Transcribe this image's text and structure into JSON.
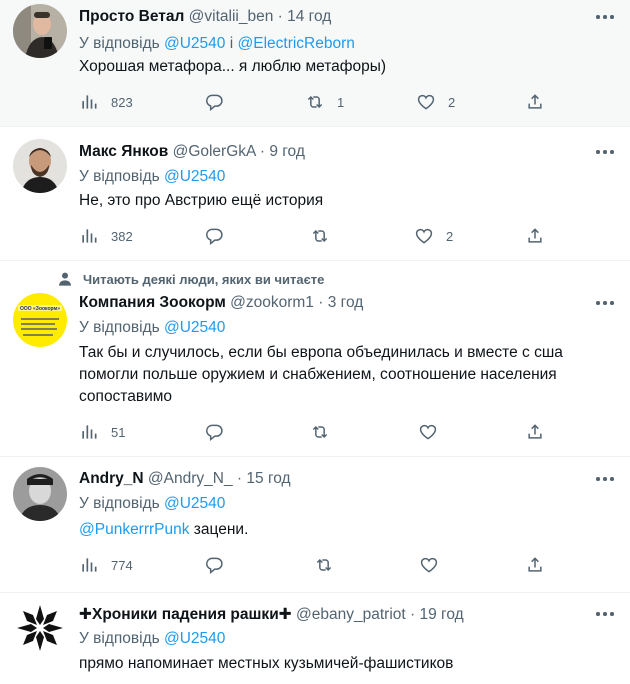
{
  "tweets": [
    {
      "name": "Просто Ветал",
      "handle": "@vitalii_ben",
      "time": "14 год",
      "reply_prefix": "У відповідь",
      "reply_to_1": "@U2540",
      "reply_joiner": "і",
      "reply_to_2": "@ElectricReborn",
      "text": "Хорошая метафора... я люблю метафоры)",
      "views": "823",
      "retweets": "1",
      "likes": "2"
    },
    {
      "name": "Макс Янков",
      "handle": "@GolerGkA",
      "time": "9 год",
      "reply_prefix": "У відповідь",
      "reply_to_1": "@U2540",
      "text": "Не, это про Австрию ещё история",
      "views": "382",
      "likes": "2"
    },
    {
      "social_context": "Читають деякі люди, яких ви читаєте",
      "name": "Компания Зоокорм",
      "handle": "@zookorm1",
      "time": "3 год",
      "avatar_text_1": "ООО «Зоокорм»",
      "reply_prefix": "У відповідь",
      "reply_to_1": "@U2540",
      "text": "Так бы и случилось, если бы европа объединилась и вместе с сша помогли польше оружием и снабжением, соотношение населения сопоставимо",
      "views": "51"
    },
    {
      "name": "Andry_N",
      "handle": "@Andry_N_",
      "time": "15 год",
      "reply_prefix": "У відповідь",
      "reply_to_1": "@U2540",
      "mention": "@PunkerrrPunk",
      "text": " зацени.",
      "views": "774"
    },
    {
      "name": "✚Хроники падения рашки✚",
      "handle": "@ebany_patriot",
      "time": "19 год",
      "reply_prefix": "У відповідь",
      "reply_to_1": "@U2540",
      "text": "прямо напоминает местных кузьмичей-фашистиков"
    }
  ],
  "dot_separator": "·",
  "colors": {
    "accent": "#1d9bf0",
    "secondary_text": "#536471",
    "highlight_bg": "#f7f9f9",
    "divider": "#eff3f4"
  },
  "icons": [
    "views-icon",
    "reply-icon",
    "retweet-icon",
    "like-icon",
    "share-icon",
    "more-icon",
    "person-icon"
  ]
}
